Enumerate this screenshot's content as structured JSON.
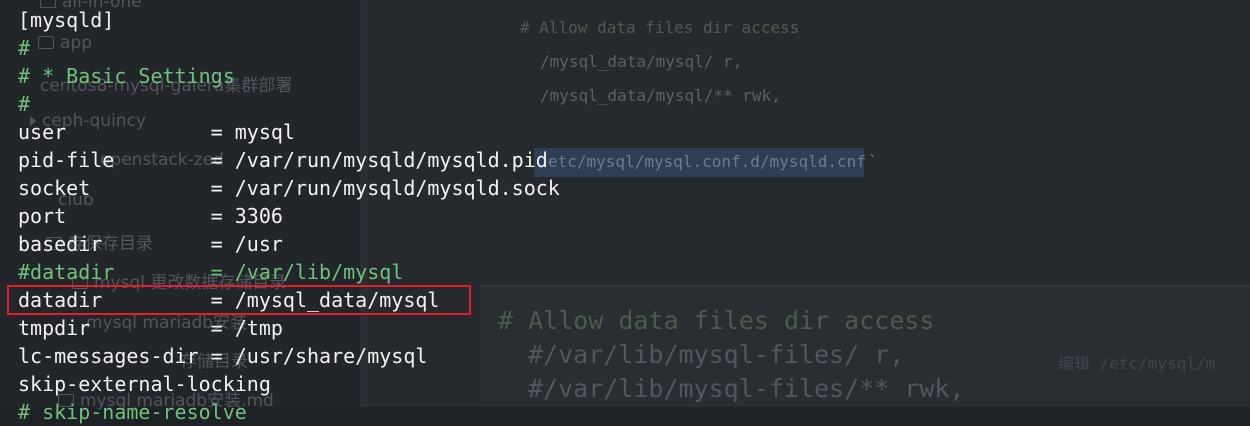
{
  "sidebar_ghost": [
    "all-in-one",
    "app",
    "centos8-mysql-galera集群部署",
    "ceph-quincy",
    "openstack-zed",
    "club",
    "存保存目录",
    "mysql 更改数据存储目录",
    "mysql mariadb安装",
    "存储目录",
    "mysql mariadb安装.md"
  ],
  "config_lines": [
    {
      "text": "[mysqld]",
      "type": "text"
    },
    {
      "text": "#",
      "type": "comment"
    },
    {
      "text": "# * Basic Settings",
      "type": "comment"
    },
    {
      "text": "#",
      "type": "comment"
    },
    {
      "text": "user            = mysql",
      "type": "text"
    },
    {
      "text": "pid-file        = /var/run/mysqld/mysqld.pid",
      "type": "text"
    },
    {
      "text": "socket          = /var/run/mysqld/mysqld.sock",
      "type": "text"
    },
    {
      "text": "port            = 3306",
      "type": "text"
    },
    {
      "text": "basedir         = /usr",
      "type": "text"
    },
    {
      "text": "#datadir        = /var/lib/mysql",
      "type": "comment"
    },
    {
      "text": "datadir         = /mysql_data/mysql",
      "type": "text"
    },
    {
      "text": "tmpdir          = /tmp",
      "type": "text"
    },
    {
      "text": "lc-messages-dir = /usr/share/mysql",
      "type": "text"
    },
    {
      "text": "skip-external-locking",
      "type": "text"
    },
    {
      "text": "# skip-name-resolve",
      "type": "comment"
    }
  ],
  "right_ghost": {
    "comment_top": "# Allow data files dir access",
    "line_a": "/mysql_data/mysql/ r,",
    "line_b": "/mysql_data/mysql/** rwk,",
    "selected_path": "etc/mysql/mysql.conf.d/mysqld.cnf",
    "selected_tail": "`",
    "big_comment": "# Allow data files dir access",
    "big_line_a": "#/var/lib/mysql-files/ r,",
    "big_line_b": "#/var/lib/mysql-files/** rwk,",
    "faint_right": "编辑 /etc/mysql/m"
  },
  "colors": {
    "text": "#f2f2f2",
    "comment": "#6fc37b",
    "highlight_border": "#e0212b",
    "background": "#1e2125"
  }
}
